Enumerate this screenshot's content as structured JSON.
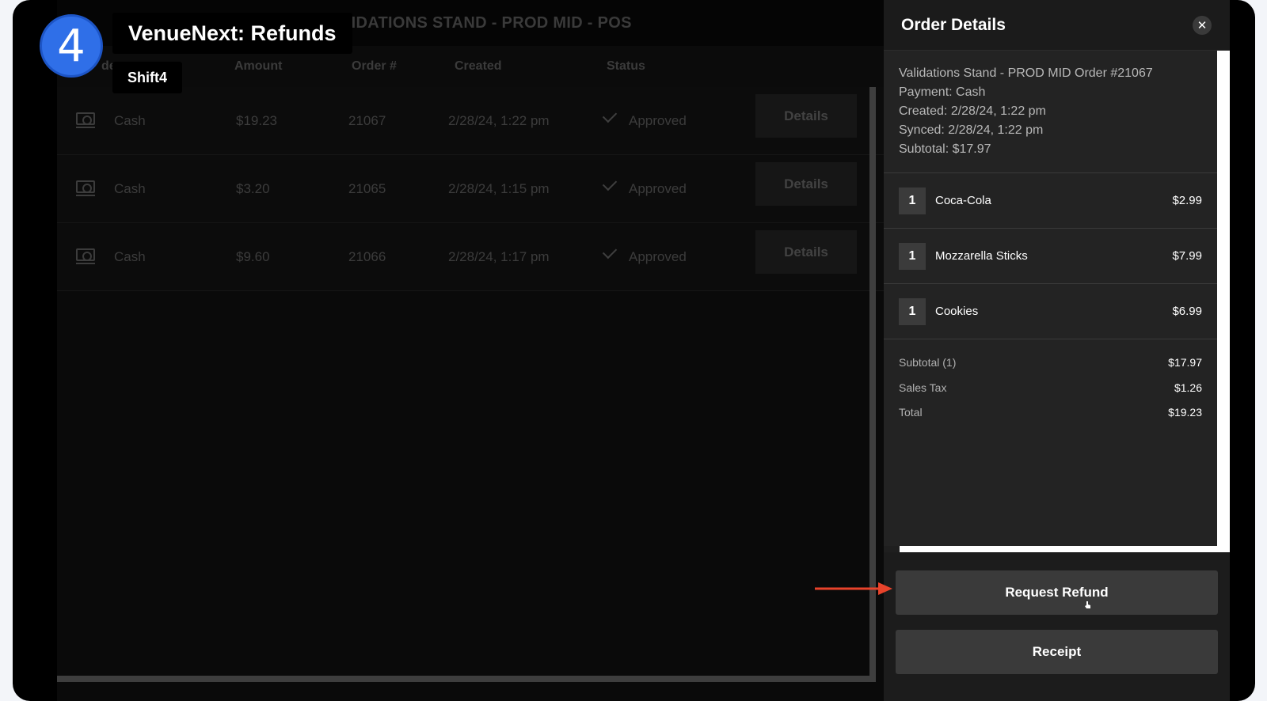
{
  "tutorial": {
    "step": "4",
    "title": "VenueNext: Refunds",
    "subtitle": "Shift4"
  },
  "pos": {
    "title": "VALIDATIONS STAND - PROD MID - POS",
    "columns": {
      "tender_partial": "der",
      "amount": "Amount",
      "order": "Order #",
      "created": "Created",
      "status": "Status"
    },
    "rows": [
      {
        "tender": "Cash",
        "amount": "$19.23",
        "order": "21067",
        "created": "2/28/24, 1:22 pm",
        "status": "Approved",
        "action": "Details"
      },
      {
        "tender": "Cash",
        "amount": "$3.20",
        "order": "21065",
        "created": "2/28/24, 1:15 pm",
        "status": "Approved",
        "action": "Details"
      },
      {
        "tender": "Cash",
        "amount": "$9.60",
        "order": "21066",
        "created": "2/28/24, 1:17 pm",
        "status": "Approved",
        "action": "Details"
      }
    ]
  },
  "panel": {
    "title": "Order Details",
    "close_label": "✕",
    "meta": {
      "order_line": "Validations Stand - PROD MID Order #21067",
      "payment": "Payment: Cash",
      "created": "Created: 2/28/24, 1:22 pm",
      "synced": "Synced: 2/28/24, 1:22 pm",
      "subtotal": "Subtotal: $17.97"
    },
    "items": [
      {
        "qty": "1",
        "name": "Coca-Cola",
        "price": "$2.99"
      },
      {
        "qty": "1",
        "name": "Mozzarella Sticks",
        "price": "$7.99"
      },
      {
        "qty": "1",
        "name": "Cookies",
        "price": "$6.99"
      }
    ],
    "summary": [
      {
        "label": "Subtotal (1)",
        "value": "$17.97"
      },
      {
        "label": "Sales Tax",
        "value": "$1.26"
      },
      {
        "label": "Total",
        "value": "$19.23"
      }
    ],
    "buttons": {
      "request_refund": "Request Refund",
      "receipt": "Receipt"
    }
  },
  "colors": {
    "badge": "#2f6fe8",
    "arrow": "#e8432b",
    "panel_bg": "#1f1f1f"
  }
}
